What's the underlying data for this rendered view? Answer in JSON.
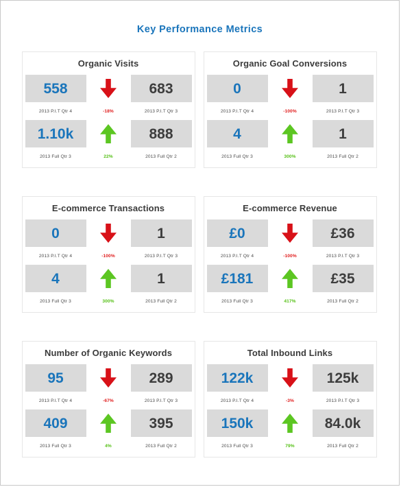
{
  "title": "Key Performance Metrics",
  "colors": {
    "title": "#1a75bb",
    "primary_value": "#1a75bb",
    "secondary_value": "#3d3d3d",
    "down_arrow": "#d81118",
    "up_arrow": "#5cc622",
    "negative_delta": "#e01b1b",
    "positive_delta": "#56c017",
    "cell_background": "#dadada",
    "panel_border": "#e6e6e6"
  },
  "panels": [
    {
      "title": "Organic Visits",
      "rows": [
        {
          "left_value": "558",
          "right_value": "683",
          "left_label": "2013 P.I.T Qtr 4",
          "right_label": "2013 P.I.T Qtr 3",
          "delta": "-18%",
          "direction": "down",
          "arrow_icon": "arrow-down-icon"
        },
        {
          "left_value": "1.10k",
          "right_value": "888",
          "left_label": "2013 Full Qtr 3",
          "right_label": "2013 Full Qtr 2",
          "delta": "22%",
          "direction": "up",
          "arrow_icon": "arrow-up-icon"
        }
      ]
    },
    {
      "title": "Organic Goal Conversions",
      "rows": [
        {
          "left_value": "0",
          "right_value": "1",
          "left_label": "2013 P.I.T Qtr 4",
          "right_label": "2013 P.I.T Qtr 3",
          "delta": "-100%",
          "direction": "down",
          "arrow_icon": "arrow-down-icon"
        },
        {
          "left_value": "4",
          "right_value": "1",
          "left_label": "2013 Full Qtr 3",
          "right_label": "2013 Full Qtr 2",
          "delta": "300%",
          "direction": "up",
          "arrow_icon": "arrow-up-icon"
        }
      ]
    },
    {
      "title": "E-commerce Transactions",
      "rows": [
        {
          "left_value": "0",
          "right_value": "1",
          "left_label": "2013 P.I.T Qtr 4",
          "right_label": "2013 P.I.T Qtr 3",
          "delta": "-100%",
          "direction": "down",
          "arrow_icon": "arrow-down-icon"
        },
        {
          "left_value": "4",
          "right_value": "1",
          "left_label": "2013 Full Qtr 3",
          "right_label": "2013 Full Qtr 2",
          "delta": "300%",
          "direction": "up",
          "arrow_icon": "arrow-up-icon"
        }
      ]
    },
    {
      "title": "E-commerce Revenue",
      "rows": [
        {
          "left_value": "£0",
          "right_value": "£36",
          "left_label": "2013 P.I.T Qtr 4",
          "right_label": "2013 P.I.T Qtr 3",
          "delta": "-100%",
          "direction": "down",
          "arrow_icon": "arrow-down-icon"
        },
        {
          "left_value": "£181",
          "right_value": "£35",
          "left_label": "2013 Full Qtr 3",
          "right_label": "2013 Full Qtr 2",
          "delta": "417%",
          "direction": "up",
          "arrow_icon": "arrow-up-icon"
        }
      ]
    },
    {
      "title": "Number of Organic Keywords",
      "rows": [
        {
          "left_value": "95",
          "right_value": "289",
          "left_label": "2013 P.I.T Qtr 4",
          "right_label": "2013 P.I.T Qtr 3",
          "delta": "-67%",
          "direction": "down",
          "arrow_icon": "arrow-down-icon"
        },
        {
          "left_value": "409",
          "right_value": "395",
          "left_label": "2013 Full Qtr 3",
          "right_label": "2013 Full Qtr 2",
          "delta": "4%",
          "direction": "up",
          "arrow_icon": "arrow-up-icon"
        }
      ]
    },
    {
      "title": "Total Inbound Links",
      "rows": [
        {
          "left_value": "122k",
          "right_value": "125k",
          "left_label": "2013 P.I.T Qtr 4",
          "right_label": "2013 P.I.T Qtr 3",
          "delta": "-3%",
          "direction": "down",
          "arrow_icon": "arrow-down-icon"
        },
        {
          "left_value": "150k",
          "right_value": "84.0k",
          "left_label": "2013 Full Qtr 3",
          "right_label": "2013 Full Qtr 2",
          "delta": "79%",
          "direction": "up",
          "arrow_icon": "arrow-up-icon"
        }
      ]
    }
  ]
}
